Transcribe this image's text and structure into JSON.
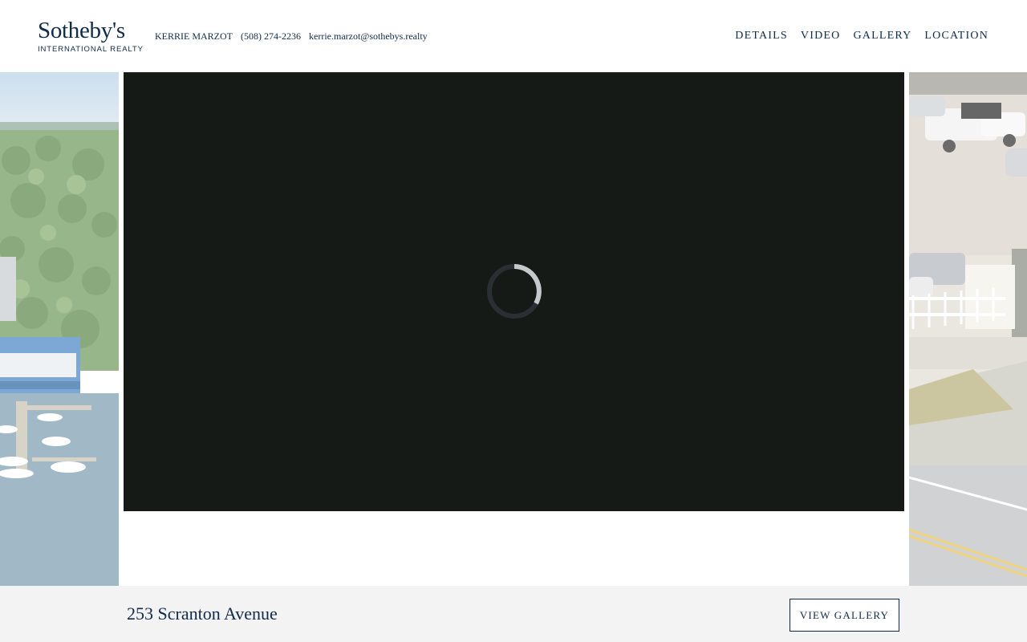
{
  "brand": {
    "name": "Sotheby's",
    "tagline": "INTERNATIONAL REALTY"
  },
  "agent": {
    "name": "KERRIE MARZOT",
    "phone": "(508) 274-2236",
    "email": "kerrie.marzot@sothebys.realty"
  },
  "nav": {
    "items": [
      {
        "label": "DETAILS"
      },
      {
        "label": "VIDEO"
      },
      {
        "label": "GALLERY"
      },
      {
        "label": "LOCATION"
      }
    ]
  },
  "video": {
    "state": "loading",
    "spinner_icon": "loading-spinner-icon"
  },
  "listing": {
    "address": "253 Scranton Avenue",
    "gallery_button": "VIEW GALLERY"
  },
  "colors": {
    "brand_navy": "#0f2a4a",
    "video_bg": "#151a17",
    "footer_bg": "#f3f3f3"
  }
}
